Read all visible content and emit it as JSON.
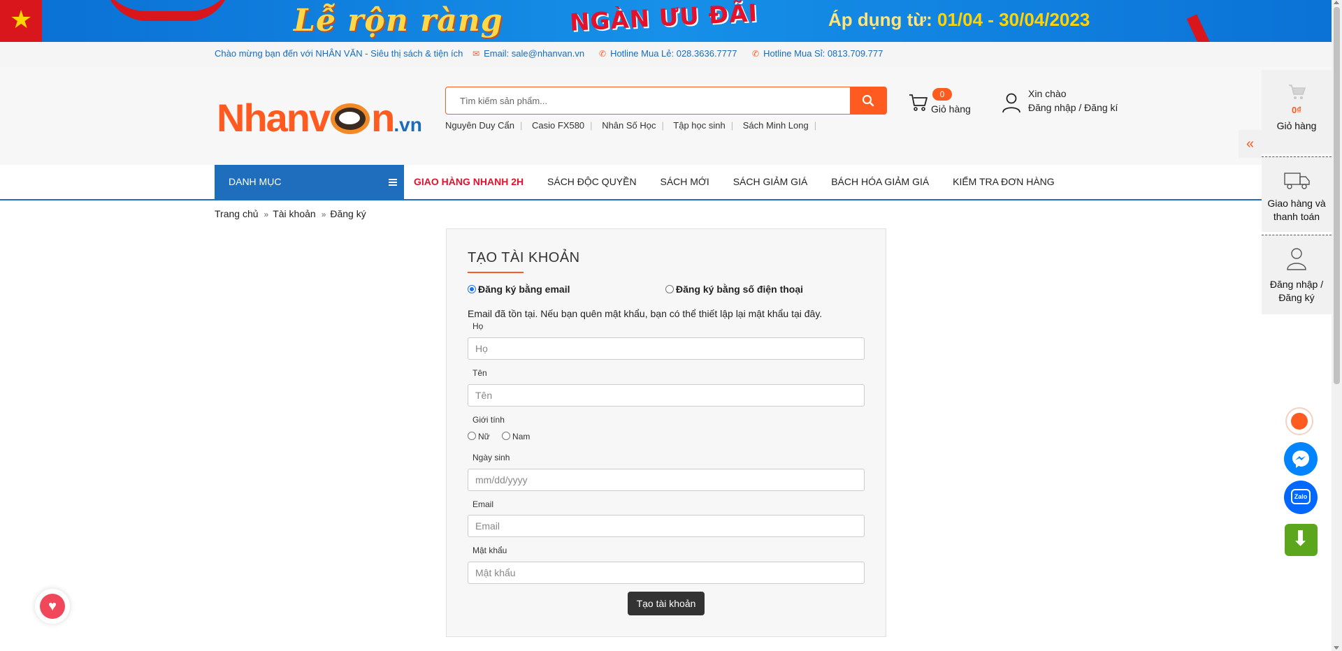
{
  "banner": {
    "slogan1": "Lễ rộn ràng",
    "slogan2": "NGÀN ƯU ĐÃI",
    "apply_prefix": "Áp dụng từ: ",
    "apply_dates": "01/04 - 30/04/2023"
  },
  "topbar": {
    "welcome": "Chào mừng bạn đến với NHÂN VĂN - Siêu thị sách & tiện ích",
    "email": "Email: sale@nhanvan.vn",
    "hotline_retail": "Hotline Mua Lẻ: 028.3636.7777",
    "hotline_wholesale": "Hotline Mua Sỉ: 0813.709.777"
  },
  "header": {
    "logo_main": "Nhanv",
    "logo_end": "n",
    "logo_tld": ".vn",
    "search_placeholder": "Tìm kiếm sản phẩm...",
    "suggestions": [
      "Nguyên Duy Cẩn",
      "Casio FX580",
      "Nhân Số Học",
      "Tập học sinh",
      "Sách Minh Long"
    ],
    "cart_count": "0",
    "cart_label": "Giỏ hàng",
    "greeting": "Xin chào",
    "login_register": "Đăng nhập / Đăng kí"
  },
  "nav": {
    "category": "DANH MỤC",
    "links": [
      "GIAO HÀNG NHANH 2H",
      "SÁCH ĐỘC QUYỀN",
      "SÁCH MỚI",
      "SÁCH GIẢM GIÁ",
      "BÁCH HÓA GIẢM GIÁ",
      "KIỂM TRA ĐƠN HÀNG"
    ]
  },
  "breadcrumb": [
    "Trang chủ",
    "Tài khoản",
    "Đăng ký"
  ],
  "form": {
    "title": "TẠO TÀI KHOẢN",
    "option_email": "Đăng ký bằng email",
    "option_phone": "Đăng ký bằng số điện thoại",
    "selected_option": "email",
    "notice": "Email đã tồn tại. Nếu bạn quên mật khẩu, bạn có thể thiết lập lại mật khẩu tại đây.",
    "last_name_label": "Họ",
    "last_name_placeholder": "Họ",
    "first_name_label": "Tên",
    "first_name_placeholder": "Tên",
    "gender_label": "Giới tính",
    "gender_female": "Nữ",
    "gender_male": "Nam",
    "dob_label": "Ngày sinh",
    "dob_placeholder": "mm/dd/yyyy",
    "email_label": "Email",
    "email_placeholder": "Email",
    "password_label": "Mật khẩu",
    "password_placeholder": "Mật khẩu",
    "submit": "Tạo tài khoản"
  },
  "side_panel": {
    "cart_total": "0₫",
    "cart_label": "Giỏ hàng",
    "shipping_line1": "Giao hàng và",
    "shipping_line2": "thanh toán",
    "login_line1": "Đăng nhập /",
    "login_line2": "Đăng ký"
  },
  "colors": {
    "brand_orange": "#ff5a1f",
    "brand_blue": "#1f6ebd",
    "hot_red": "#e3122c"
  },
  "icons": [
    "mail-icon",
    "phone-icon",
    "search-icon",
    "cart-icon",
    "user-icon",
    "menu-icon",
    "chevron-double-left-icon",
    "truck-icon",
    "heart-icon",
    "messenger-icon",
    "zalo-icon",
    "download-icon"
  ]
}
